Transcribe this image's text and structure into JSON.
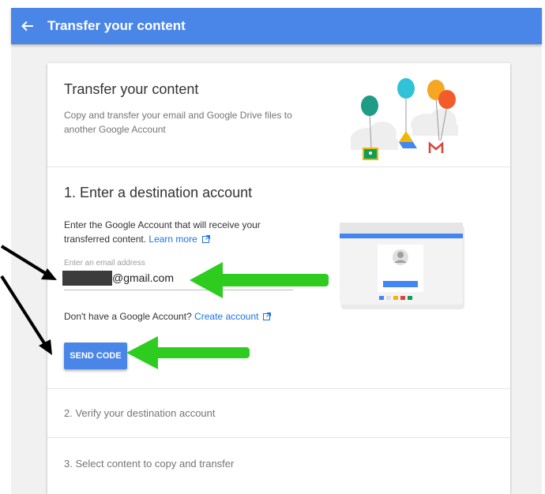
{
  "app_bar": {
    "title": "Transfer your content",
    "back_icon": "arrow-back-icon",
    "color": "#4a86e8"
  },
  "intro": {
    "title": "Transfer your content",
    "description": "Copy and transfer your email and Google Drive files to another Google Account",
    "illustration": "balloons-cloud-illustration"
  },
  "step1": {
    "title": "1. Enter a destination account",
    "description": "Enter the Google Account that will receive your transferred content.",
    "learn_more": "Learn more",
    "email_placeholder": "Enter an email address",
    "email_value": "@gmail.com",
    "no_account_text": "Don't have a Google Account?",
    "create_account": "Create account",
    "send_code": "SEND CODE",
    "illustration": "account-window-illustration"
  },
  "step2": {
    "title": "2. Verify your destination account"
  },
  "step3": {
    "title": "3. Select content to copy and transfer"
  },
  "annotations": {
    "black_arrow_color": "#000000",
    "green_arrow_color": "#2ecc1f"
  }
}
